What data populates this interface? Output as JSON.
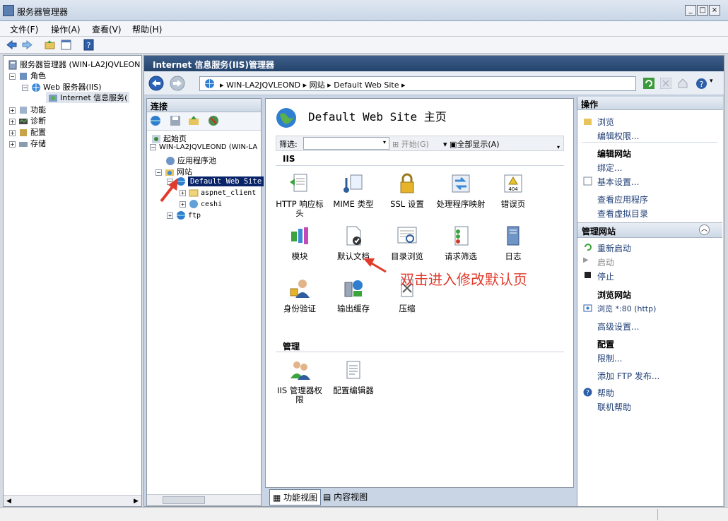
{
  "window": {
    "title": "服务器管理器"
  },
  "menu": [
    "文件(F)",
    "操作(A)",
    "查看(V)",
    "帮助(H)"
  ],
  "left_tree": {
    "root": "服务器管理器 (WIN-LA2JQVLEON",
    "roles": "角色",
    "web_server": "Web 服务器(IIS)",
    "iis_manager": "Internet 信息服务(",
    "features": "功能",
    "diagnostics": "诊断",
    "config": "配置",
    "storage": "存储"
  },
  "iis": {
    "header": "Internet 信息服务(IIS)管理器",
    "address": [
      "WIN-LA2JQVLEOND",
      "网站",
      "Default Web Site"
    ]
  },
  "connections": {
    "title": "连接",
    "start_page": "起始页",
    "server": "WIN-LA2JQVLEOND (WIN-LA",
    "app_pools": "应用程序池",
    "sites": "网站",
    "default_site": "Default Web Site",
    "aspnet": "aspnet_client",
    "ceshi": "ceshi",
    "ftp": "ftp"
  },
  "center": {
    "title": "Default Web Site 主页",
    "filter_label": "筛选:",
    "start_btn": "开始(G)",
    "show_all": "全部显示(A)",
    "section_iis": "IIS",
    "section_manage": "管理",
    "features_iis": [
      "HTTP 响应标头",
      "MIME 类型",
      "SSL 设置",
      "处理程序映射",
      "错误页",
      "模块",
      "默认文档",
      "目录浏览",
      "请求筛选",
      "日志",
      "身份验证",
      "输出缓存",
      "压缩"
    ],
    "features_manage": [
      "IIS 管理器权限",
      "配置编辑器"
    ]
  },
  "view_tabs": {
    "feature_view": "功能视图",
    "content_view": "内容视图"
  },
  "actions": {
    "title": "操作",
    "browse": "浏览",
    "edit_perms": "编辑权限...",
    "edit_site_group": "编辑网站",
    "bindings": "绑定...",
    "basic_settings": "基本设置...",
    "view_apps": "查看应用程序",
    "view_vdirs": "查看虚拟目录",
    "manage_site": "管理网站",
    "restart": "重新启动",
    "start": "启动",
    "stop": "停止",
    "browse_site_group": "浏览网站",
    "browse_80": "浏览 *:80 (http)",
    "advanced": "高级设置...",
    "config_group": "配置",
    "limits": "限制...",
    "add_ftp": "添加 FTP 发布...",
    "help": "帮助",
    "online_help": "联机帮助"
  },
  "annotation": "双击进入修改默认页",
  "colors": {
    "accent": "#24446c",
    "annotation": "#e13b2c"
  }
}
